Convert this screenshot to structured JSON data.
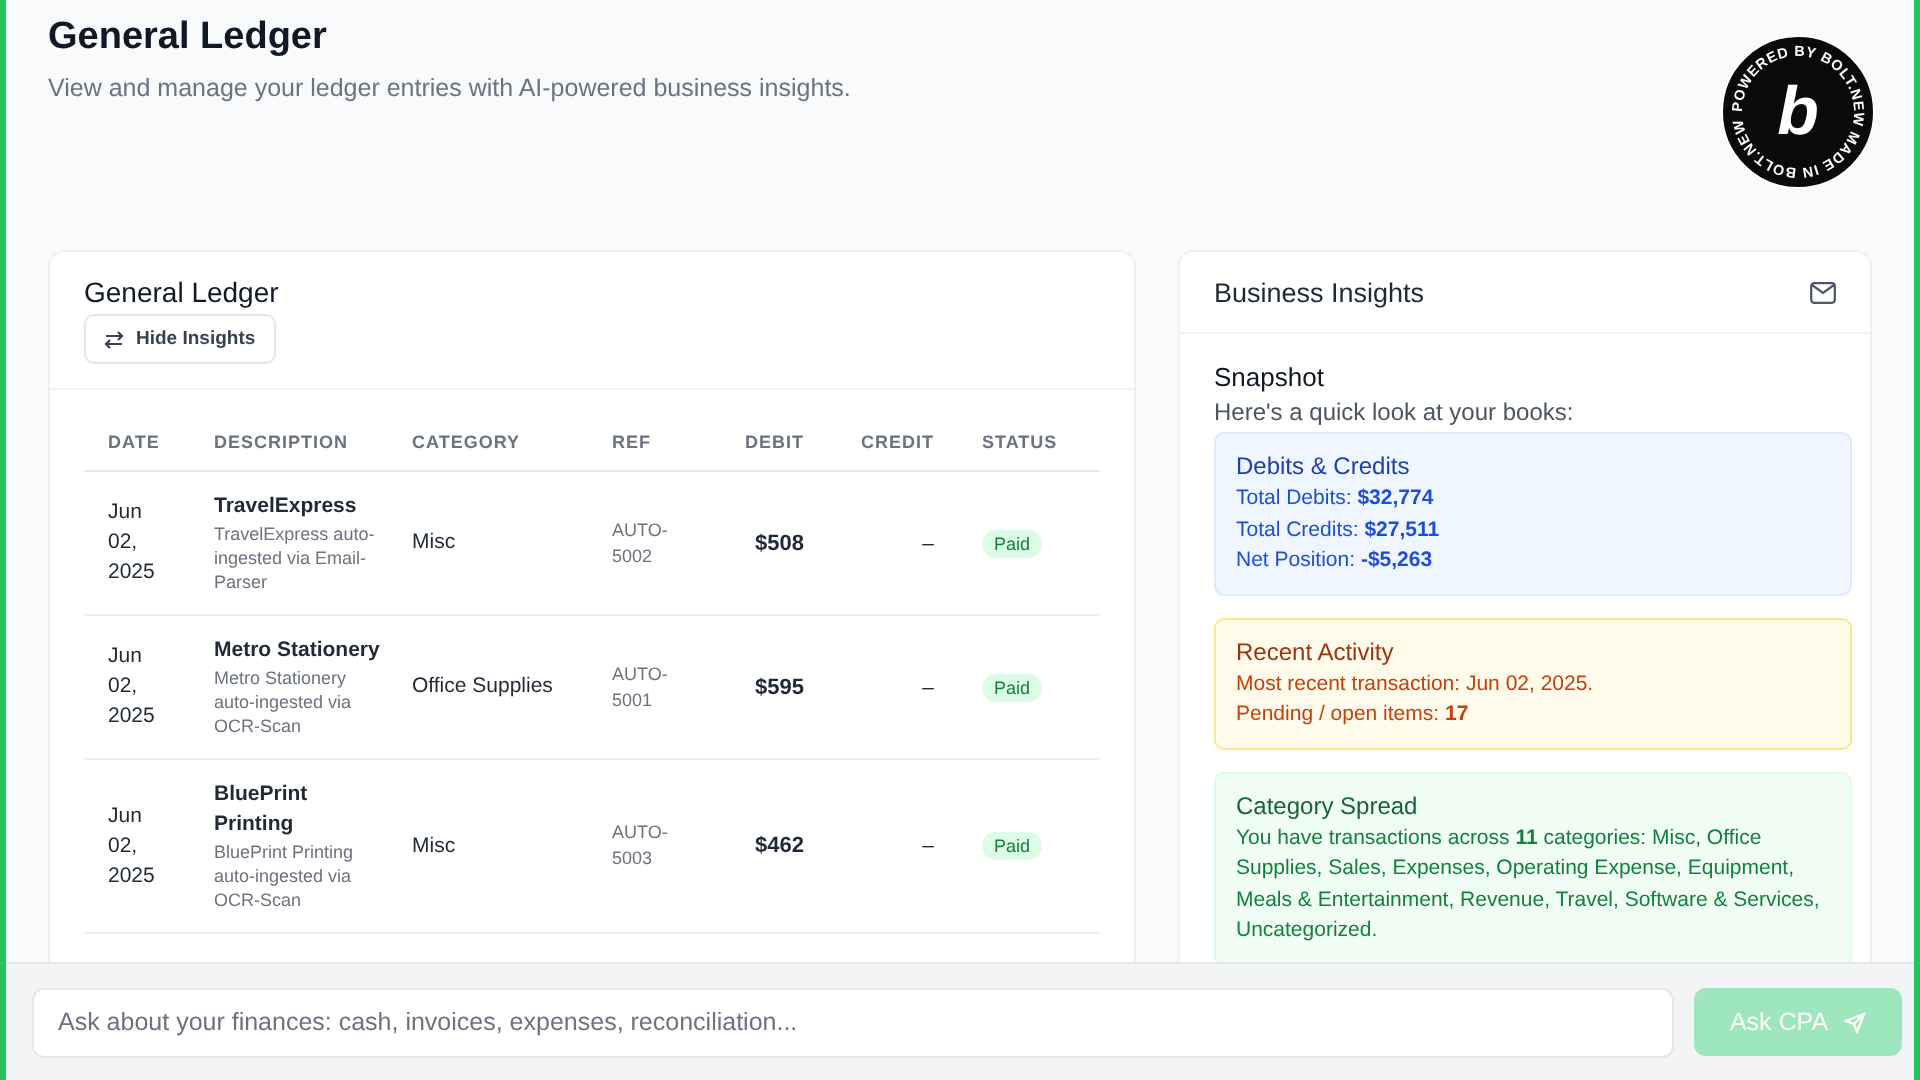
{
  "header": {
    "title": "General Ledger",
    "subtitle": "View and manage your ledger entries with AI-powered business insights."
  },
  "badge": {
    "ring_text": "POWERED BY BOLT.NEW MADE IN BOLT.NEW",
    "letter": "b"
  },
  "ledger": {
    "title": "General Ledger",
    "toggle_button": "Hide Insights",
    "table": {
      "columns": [
        "DATE",
        "DESCRIPTION",
        "CATEGORY",
        "REF",
        "DEBIT",
        "CREDIT",
        "STATUS"
      ],
      "rows": [
        {
          "date": "Jun 02, 2025",
          "name": "TravelExpress",
          "note": "TravelExpress auto-ingested via Email-Parser",
          "category": "Misc",
          "ref": "AUTO-5002",
          "debit": "$508",
          "credit": "–",
          "status": {
            "label": "Paid",
            "kind": "paid"
          }
        },
        {
          "date": "Jun 02, 2025",
          "name": "Metro Stationery",
          "note": "Metro Stationery auto-ingested via OCR-Scan",
          "category": "Office Supplies",
          "ref": "AUTO-5001",
          "debit": "$595",
          "credit": "–",
          "status": {
            "label": "Paid",
            "kind": "paid"
          }
        },
        {
          "date": "Jun 02, 2025",
          "name": "BluePrint Printing",
          "note": "BluePrint Printing auto-ingested via OCR-Scan",
          "category": "Misc",
          "ref": "AUTO-5003",
          "debit": "$462",
          "credit": "–",
          "status": {
            "label": "Paid",
            "kind": "paid"
          }
        }
      ]
    }
  },
  "insights": {
    "title": "Business Insights",
    "section_title": "Snapshot",
    "section_intro": "Here's a quick look at your books:",
    "cards": [
      {
        "kind": "info",
        "title": "Debits & Credits",
        "lines": [
          "Total Debits: **$32,774**",
          "Total Credits: **$27,511**",
          "Net Position: **-$5,263**"
        ]
      },
      {
        "kind": "warning",
        "title": "Recent Activity",
        "lines": [
          "Most recent transaction: Jun 02, 2025.",
          "Pending / open items: **17**"
        ]
      },
      {
        "kind": "success",
        "title": "Category Spread",
        "lines": [
          "You have transactions across **11** categories: Misc, Office Supplies, Sales, Expenses, Operating Expense, Equipment, Meals & Entertainment, Revenue, Travel, Software & Services, Uncategorized."
        ]
      }
    ]
  },
  "ask_bar": {
    "placeholder": "Ask about your finances: cash, invoices, expenses, reconciliation...",
    "button": "Ask CPA",
    "button_disabled": true
  }
}
